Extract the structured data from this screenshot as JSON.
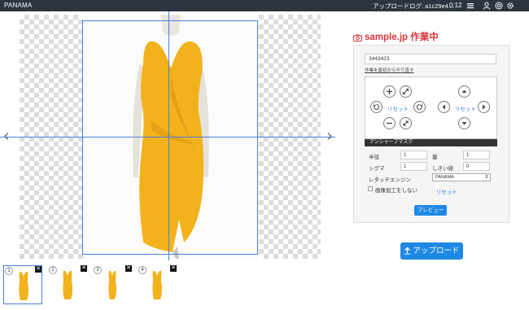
{
  "topbar": {
    "brand": "PANAMA",
    "upload_log": "アップロードログ: a1c29e4...",
    "timer": "0:12",
    "icons": [
      "menu-icon",
      "user-icon",
      "at-icon",
      "gear-icon"
    ]
  },
  "panel": {
    "site_title": "sample.jp 作業中",
    "item_id": "3443423",
    "reset_all": "作業を最初からやり直す",
    "reset_zoom": "リセット",
    "reset_move": "リセット",
    "section_title": "アンシャープマスク",
    "fields": {
      "radius_label": "半径",
      "radius_value": "1",
      "amount_label": "量",
      "amount_value": "1",
      "sigma_label": "シグマ",
      "sigma_value": "1",
      "threshold_label": "しきい値",
      "threshold_value": "0"
    },
    "engine_label": "レタッチエンジン",
    "engine_value": "PANAMA",
    "no_processing_label": "画像加工をしない",
    "reset_filter": "リセット",
    "preview_button": "プレビュー",
    "upload_button": "アップロード"
  },
  "thumbnails": [
    {
      "number": "1",
      "active": true
    },
    {
      "number": "2",
      "active": false
    },
    {
      "number": "3",
      "active": false
    },
    {
      "number": "4",
      "active": false
    }
  ],
  "colors": {
    "accent": "#1e88e5",
    "guide": "#4a7ee0",
    "brand_red": "#d9343d",
    "dress": "#f2b21b"
  }
}
